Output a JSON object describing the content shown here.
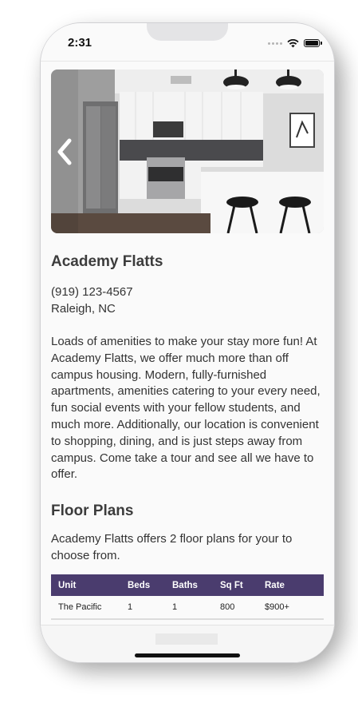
{
  "status_bar": {
    "time": "2:31"
  },
  "carousel": {
    "prev_icon": "chevron-left-icon",
    "image": "kitchen-photo"
  },
  "property": {
    "name": "Academy Flatts",
    "phone": "(919) 123-4567",
    "location": "Raleigh, NC",
    "description": "Loads of amenities to make your stay more fun! At Academy Flatts, we offer much more than off campus housing. Modern, fully-furnished apartments, amenities catering to your every need, fun social events with your fellow students, and much more. Additionally, our location is convenient to shopping, dining, and is just steps away from campus.   Come take a tour and see all we have to offer."
  },
  "floor_plans": {
    "heading": "Floor Plans",
    "intro": "Academy Flatts offers 2 floor plans for your to choose from.",
    "columns": [
      "Unit",
      "Beds",
      "Baths",
      "Sq Ft",
      "Rate"
    ],
    "rows": [
      [
        "The Pacific",
        "1",
        "1",
        "800",
        "$900+"
      ]
    ]
  },
  "colors": {
    "table_header": "#4a3c6e",
    "background": "#fafafa"
  }
}
